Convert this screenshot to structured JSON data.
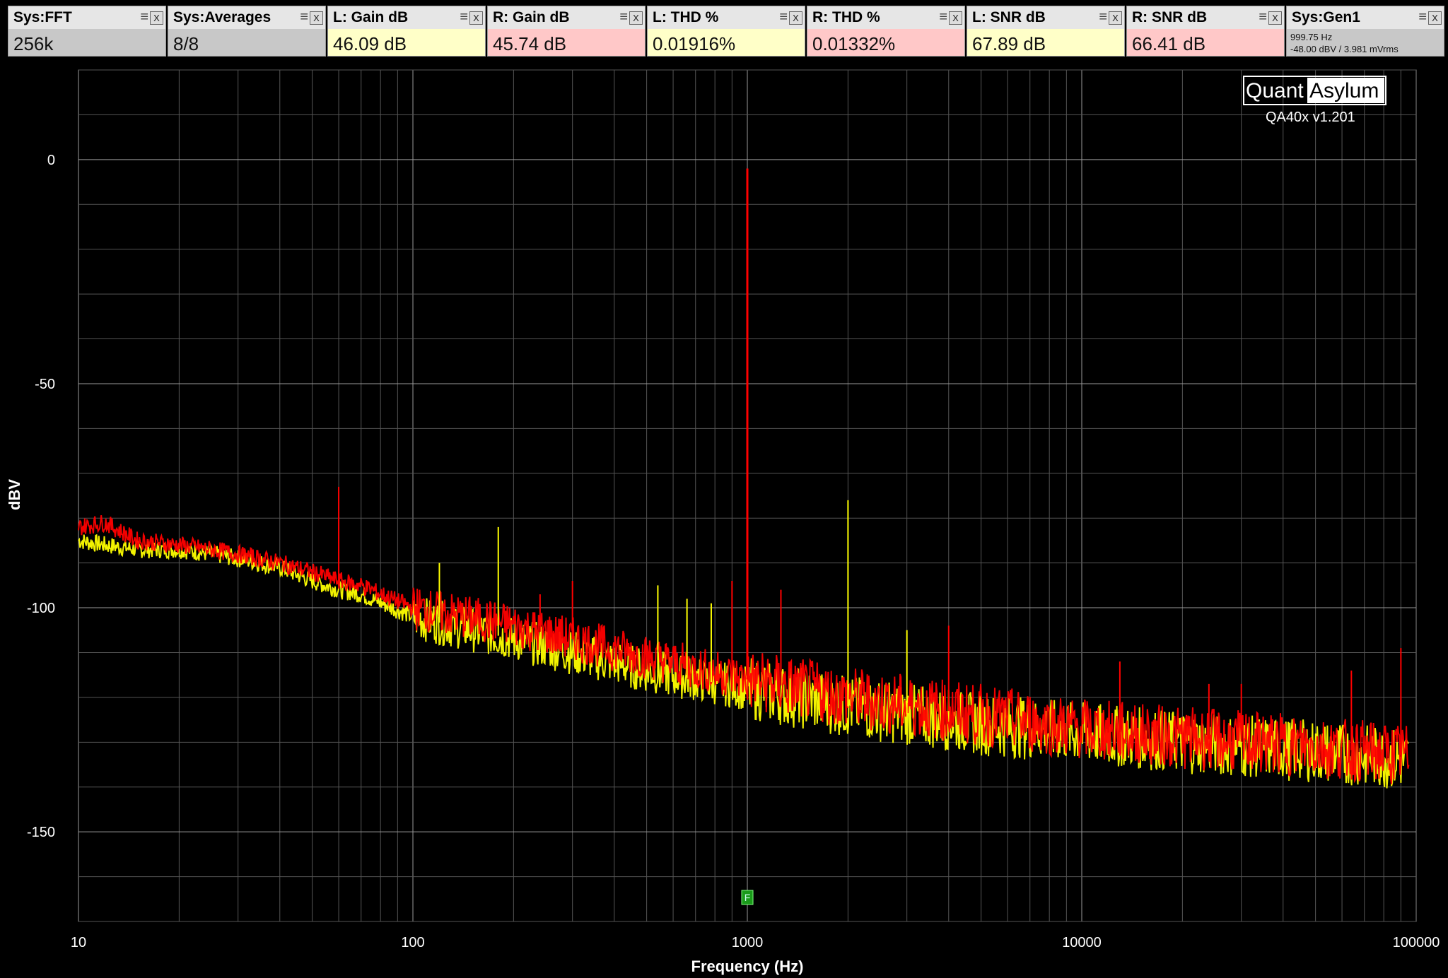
{
  "tiles": [
    {
      "title": "Sys:FFT",
      "value": "256k",
      "bg": "#c8c8c8"
    },
    {
      "title": "Sys:Averages",
      "value": "8/8",
      "bg": "#c8c8c8"
    },
    {
      "title": "L: Gain dB",
      "value": "46.09 dB",
      "bg": "#ffffc8"
    },
    {
      "title": "R: Gain dB",
      "value": "45.74 dB",
      "bg": "#ffc8c8"
    },
    {
      "title": "L: THD %",
      "value": "0.01916%",
      "bg": "#ffffc8"
    },
    {
      "title": "R: THD %",
      "value": "0.01332%",
      "bg": "#ffc8c8"
    },
    {
      "title": "L: SNR dB",
      "value": "67.89 dB",
      "bg": "#ffffc8"
    },
    {
      "title": "R: SNR dB",
      "value": "66.41 dB",
      "bg": "#ffc8c8"
    },
    {
      "title": "Sys:Gen1",
      "line1": "999.75 Hz",
      "line2": "-48.00 dBV  / 3.981 mVrms",
      "bg": "#c8c8c8"
    }
  ],
  "logo": {
    "left": "Quant",
    "right": "Asylum",
    "version": "QA40x v1.201"
  },
  "marker_label": "F",
  "chart_data": {
    "type": "line",
    "xscale": "log",
    "xlim": [
      10,
      100000
    ],
    "ylim": [
      -170,
      20
    ],
    "xlabel": "Frequency (Hz)",
    "ylabel": "dBV",
    "xticks": [
      10,
      100,
      1000,
      10000,
      100000
    ],
    "yticks": [
      0,
      -50,
      -100,
      -150
    ],
    "grid": true,
    "series": [
      {
        "color": "#ffff00",
        "x": [
          10,
          12,
          15,
          20,
          25,
          30,
          40,
          50,
          60,
          70,
          100,
          200,
          300,
          500,
          1000,
          2000,
          5000,
          10000,
          20000,
          50000,
          95000
        ],
        "y": [
          -85,
          -86,
          -87,
          -87,
          -88,
          -89,
          -91,
          -94,
          -96,
          -97,
          -102,
          -107,
          -110,
          -114,
          -118,
          -122,
          -126,
          -128,
          -130,
          -132,
          -134
        ]
      },
      {
        "color": "#ff0000",
        "x": [
          10,
          12,
          15,
          20,
          25,
          30,
          40,
          50,
          60,
          70,
          100,
          200,
          300,
          500,
          1000,
          2000,
          5000,
          10000,
          20000,
          50000,
          95000
        ],
        "y": [
          -82,
          -81,
          -85,
          -86,
          -87,
          -88,
          -90,
          -92,
          -94,
          -95,
          -100,
          -104,
          -107,
          -111,
          -116,
          -120,
          -124,
          -127,
          -129,
          -131,
          -133
        ]
      }
    ],
    "peaks": [
      {
        "f": 60,
        "db": -73,
        "color": "#ff0000"
      },
      {
        "f": 180,
        "db": -82,
        "color": "#ffff00"
      },
      {
        "f": 120,
        "db": -90,
        "color": "#ffff00"
      },
      {
        "f": 240,
        "db": -97,
        "color": "#ff0000"
      },
      {
        "f": 300,
        "db": -94,
        "color": "#ff0000"
      },
      {
        "f": 540,
        "db": -95,
        "color": "#ffff00"
      },
      {
        "f": 660,
        "db": -98,
        "color": "#ffff00"
      },
      {
        "f": 780,
        "db": -99,
        "color": "#ffff00"
      },
      {
        "f": 900,
        "db": -94,
        "color": "#ff0000"
      },
      {
        "f": 1000,
        "db": -2,
        "color": "#ff0000"
      },
      {
        "f": 1260,
        "db": -96,
        "color": "#ff0000"
      },
      {
        "f": 2000,
        "db": -76,
        "color": "#ffff00"
      },
      {
        "f": 3000,
        "db": -105,
        "color": "#ffff00"
      },
      {
        "f": 4000,
        "db": -104,
        "color": "#ff0000"
      },
      {
        "f": 13000,
        "db": -112,
        "color": "#ff0000"
      },
      {
        "f": 24000,
        "db": -117,
        "color": "#ff0000"
      },
      {
        "f": 30000,
        "db": -117,
        "color": "#ff0000"
      },
      {
        "f": 64000,
        "db": -114,
        "color": "#ff0000"
      },
      {
        "f": 90000,
        "db": -109,
        "color": "#ff0000"
      }
    ],
    "marker": {
      "f": 1000
    }
  }
}
